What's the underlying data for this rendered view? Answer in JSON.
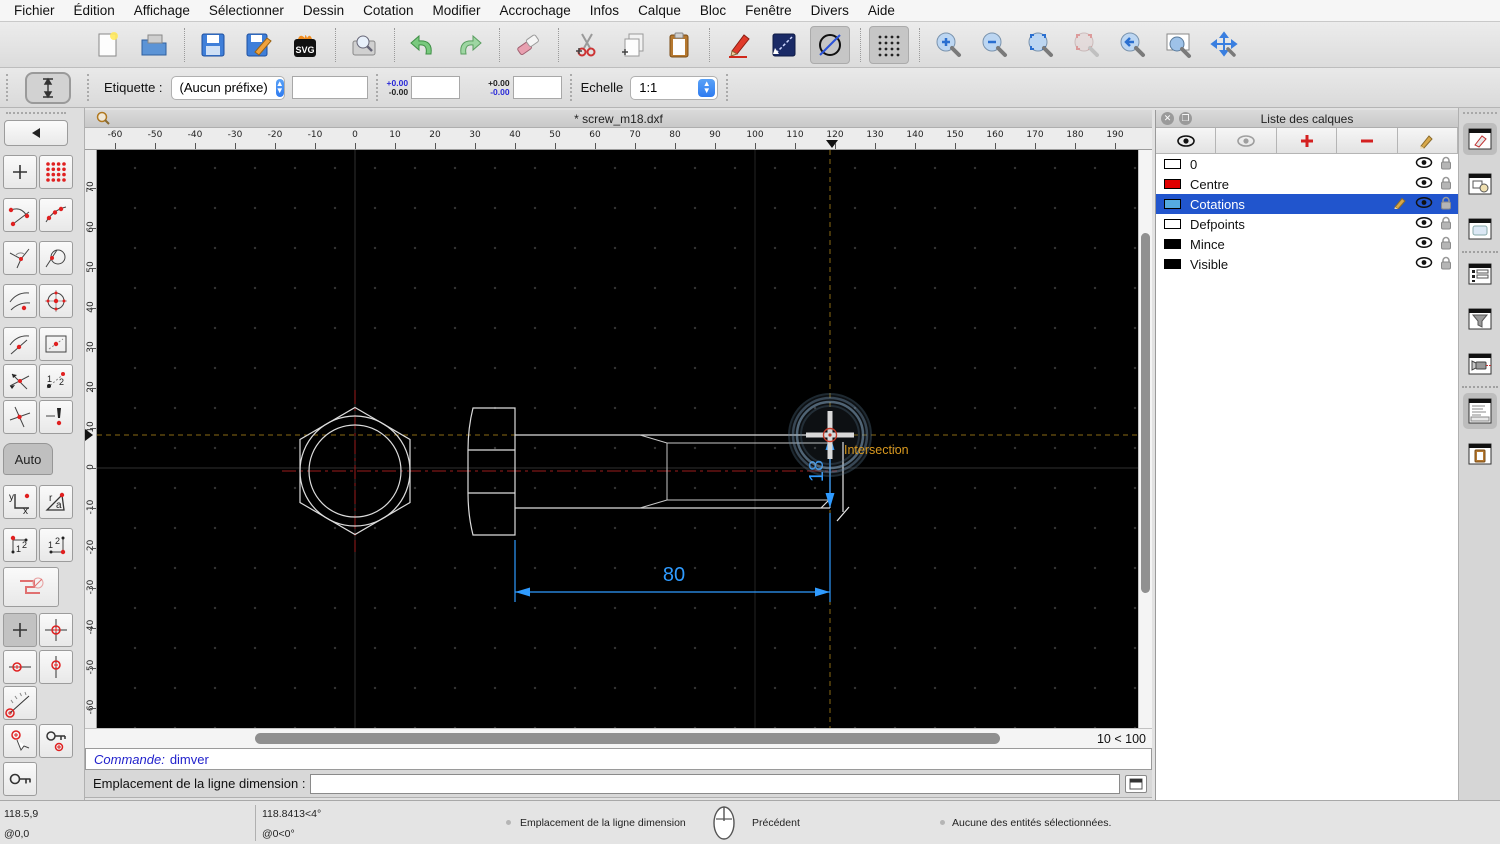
{
  "menubar": {
    "items": [
      "Fichier",
      "Édition",
      "Affichage",
      "Sélectionner",
      "Dessin",
      "Cotation",
      "Modifier",
      "Accrochage",
      "Infos",
      "Calque",
      "Bloc",
      "Fenêtre",
      "Divers",
      "Aide"
    ]
  },
  "toolbar": {
    "svg_label": "SVG"
  },
  "dim_toolbar": {
    "label_prefix": "Etiquette :",
    "prefix_value": "(Aucun préfixe)",
    "custom_value": "",
    "tol1_upper": "+0.00",
    "tol1_lower": "-0.00",
    "tol1_value": "",
    "tol2_upper": "+0.00",
    "tol2_lower": "-0.00",
    "tol2_value": "",
    "scale_label": "Echelle",
    "scale_value": "1:1"
  },
  "snap_sidebar": {
    "auto_label": "Auto",
    "coord_y": "y",
    "coord_x": "x",
    "coord_r": "r",
    "coord_a": "a",
    "num1": "1",
    "num2": "2"
  },
  "document": {
    "title": "* screw_m18.dxf",
    "hruler": [
      "-60",
      "-50",
      "-40",
      "-30",
      "-20",
      "-10",
      "0",
      "10",
      "20",
      "30",
      "40",
      "50",
      "60",
      "70",
      "80",
      "90",
      "100",
      "110",
      "120",
      "130",
      "140",
      "150",
      "160",
      "170",
      "180",
      "190"
    ],
    "vruler": [
      "70",
      "60",
      "50",
      "40",
      "30",
      "20",
      "10",
      "0",
      "-10",
      "-20",
      "-30",
      "-40",
      "-50",
      "-60"
    ],
    "grid_status": "10 < 100",
    "dim_length": "80",
    "dim_height": "18",
    "snap_tooltip": "Intersection"
  },
  "command": {
    "history_label": "Commande:",
    "history_value": "dimver",
    "prompt_label": "Emplacement de la ligne dimension :",
    "prompt_value": ""
  },
  "layers_panel": {
    "title": "Liste des calques",
    "layers": [
      {
        "name": "0",
        "color": "#ffffff",
        "selected": false,
        "editing": false
      },
      {
        "name": "Centre",
        "color": "#e00000",
        "selected": false,
        "editing": false
      },
      {
        "name": "Cotations",
        "color": "#55aae0",
        "selected": true,
        "editing": true
      },
      {
        "name": "Defpoints",
        "color": "#ffffff",
        "selected": false,
        "editing": false
      },
      {
        "name": "Mince",
        "color": "#000000",
        "selected": false,
        "editing": false
      },
      {
        "name": "Visible",
        "color": "#000000",
        "selected": false,
        "editing": false
      }
    ]
  },
  "statusbar": {
    "cartesian_abs": "118.5,9",
    "cartesian_rel": "@0,0",
    "polar_abs": "118.8413<4°",
    "polar_rel": "@0<0°",
    "left_hint": "Emplacement de la ligne dimension",
    "right_hint": "Précédent",
    "selection_info": "Aucune des entités sélectionnées."
  },
  "colors": {
    "dimension_blue": "#2f9bff",
    "snap_guide": "#8a6a14",
    "snap_label": "#d9991f",
    "centerline_red": "#9b1b1b",
    "selection_blue": "#2155cd"
  }
}
